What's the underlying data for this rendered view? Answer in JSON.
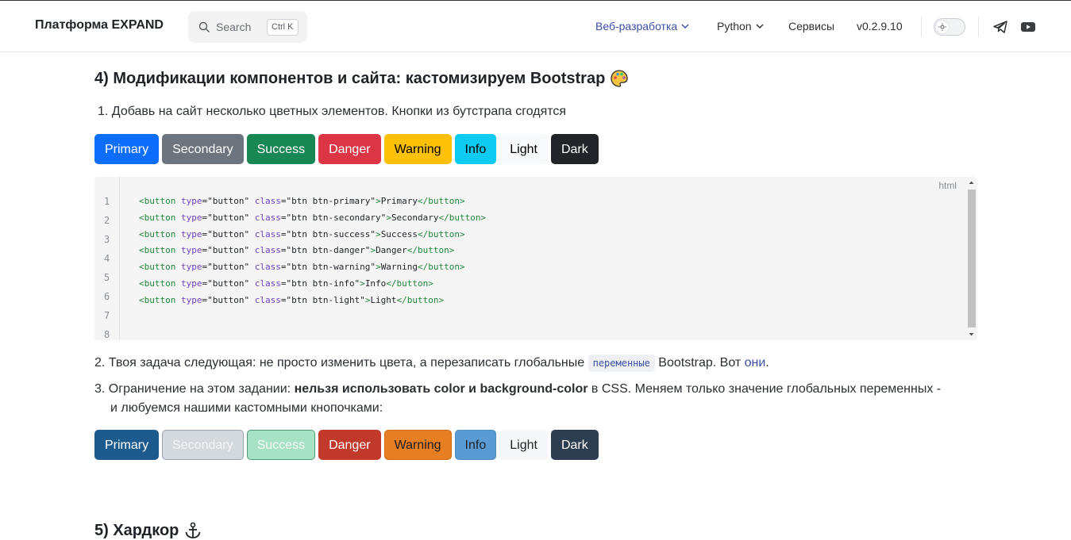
{
  "header": {
    "brand": "Платформа EXPAND",
    "search": {
      "placeholder": "Search",
      "shortcut": "Ctrl K"
    },
    "nav": [
      {
        "label": "Веб-разработка",
        "has_dropdown": true,
        "active": true
      },
      {
        "label": "Python",
        "has_dropdown": true,
        "active": false
      },
      {
        "label": "Сервисы",
        "has_dropdown": false,
        "active": false
      },
      {
        "label": "v0.2.9.10",
        "has_dropdown": false,
        "active": false
      }
    ],
    "theme_toggle": "sun-icon",
    "social": [
      "telegram-icon",
      "youtube-icon"
    ]
  },
  "section4": {
    "title": "4) Модификации компонентов и сайта: кастомизируем Bootstrap",
    "title_icon": "palette-icon",
    "step1": "Добавь на сайт несколько цветных элементов. Кнопки из бутстрапа сгодятся",
    "buttons_default": [
      {
        "label": "Primary",
        "bg": "#0d6efd",
        "fg": "#ffffff",
        "border": "#0d6efd"
      },
      {
        "label": "Secondary",
        "bg": "#6c757d",
        "fg": "#ffffff",
        "border": "#6c757d"
      },
      {
        "label": "Success",
        "bg": "#198754",
        "fg": "#ffffff",
        "border": "#198754"
      },
      {
        "label": "Danger",
        "bg": "#dc3545",
        "fg": "#ffffff",
        "border": "#dc3545"
      },
      {
        "label": "Warning",
        "bg": "#ffc107",
        "fg": "#000000",
        "border": "#ffc107"
      },
      {
        "label": "Info",
        "bg": "#0dcaf0",
        "fg": "#000000",
        "border": "#0dcaf0"
      },
      {
        "label": "Light",
        "bg": "#f8f9fa",
        "fg": "#000000",
        "border": "#f8f9fa"
      },
      {
        "label": "Dark",
        "bg": "#212529",
        "fg": "#ffffff",
        "border": "#212529"
      }
    ],
    "code": {
      "language": "html",
      "lines": [
        {
          "no": "1",
          "cls": "btn btn-primary",
          "text": "Primary"
        },
        {
          "no": "2",
          "cls": "btn btn-secondary",
          "text": "Secondary"
        },
        {
          "no": "3",
          "cls": "btn btn-success",
          "text": "Success"
        },
        {
          "no": "4",
          "cls": "btn btn-danger",
          "text": "Danger"
        },
        {
          "no": "5",
          "cls": "btn btn-warning",
          "text": "Warning"
        },
        {
          "no": "6",
          "cls": "btn btn-info",
          "text": "Info"
        },
        {
          "no": "7",
          "cls": "btn btn-light",
          "text": "Light"
        },
        {
          "no": "8",
          "cls": "",
          "text": ""
        }
      ],
      "tag_open": "<button",
      "type_attr": "type",
      "type_val": "\"button\"",
      "class_attr": "class",
      "tag_close": "</button>"
    },
    "step2": {
      "before": "Твоя задача следующая: не просто изменить цвета, а перезаписать глобальные ",
      "code": "переменные",
      "middle": " Bootstrap. Вот ",
      "link": "они",
      "after": "."
    },
    "step3": {
      "before": "Ограничение на этом задании: ",
      "bold": "нельзя использовать color и background-color",
      "after_line1": " в CSS. Меняем только значение глобальных переменных -",
      "line2": "и любуемся нашими кастомными кнопочками:"
    },
    "buttons_custom": [
      {
        "label": "Primary",
        "bg": "#1d5b8f",
        "fg": "#ffffff",
        "border": "#1d5b8f"
      },
      {
        "label": "Secondary",
        "bg": "#d4d9de",
        "fg": "#f3f4f6",
        "border": "#9aa2ab"
      },
      {
        "label": "Success",
        "bg": "#a8e2c4",
        "fg": "#f2fbf6",
        "border": "#4f9a73"
      },
      {
        "label": "Danger",
        "bg": "#c0392b",
        "fg": "#ffffff",
        "border": "#c0392b"
      },
      {
        "label": "Warning",
        "bg": "#e67e22",
        "fg": "#1f1f1f",
        "border": "#d06d12"
      },
      {
        "label": "Info",
        "bg": "#5a9bd4",
        "fg": "#1f2328",
        "border": "#4a8cc6"
      },
      {
        "label": "Light",
        "bg": "#f6f7f8",
        "fg": "#1f2328",
        "border": "#f6f7f8"
      },
      {
        "label": "Dark",
        "bg": "#2c3e50",
        "fg": "#ffffff",
        "border": "#2c3e50"
      }
    ]
  },
  "section5": {
    "title": "5) Хардкор",
    "title_icon": "anchor-icon"
  }
}
